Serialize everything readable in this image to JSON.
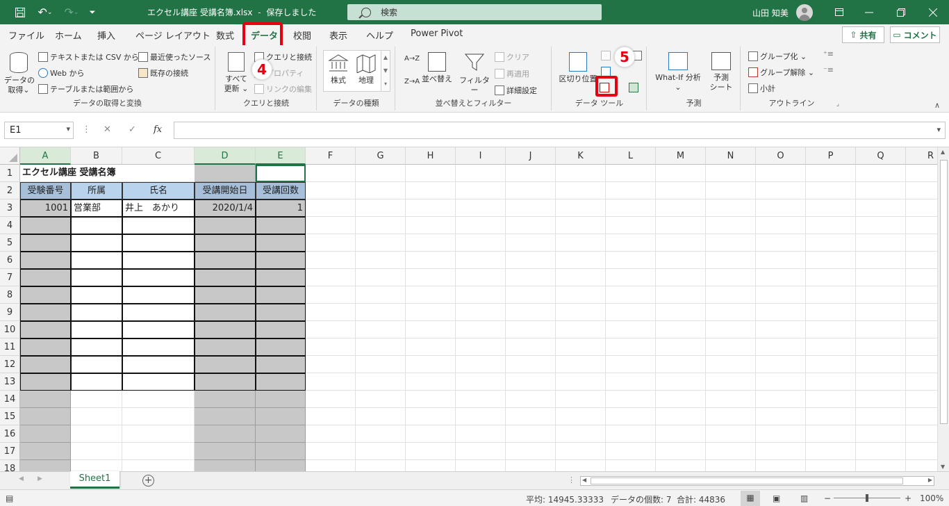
{
  "title": {
    "filename": "エクセル講座 受講名簿.xlsx",
    "sep": "-",
    "status": "保存しました",
    "search": "検索",
    "user": "山田 知美"
  },
  "tabs": [
    "ファイル",
    "ホーム",
    "挿入",
    "ページ レイアウト",
    "数式",
    "データ",
    "校閲",
    "表示",
    "ヘルプ",
    "Power Pivot"
  ],
  "share": "共有",
  "comment": "コメント",
  "ribbon": {
    "get_data": {
      "big": "データの\n取得",
      "big_arrow": "⌄",
      "items": [
        "テキストまたは CSV から",
        "Web から",
        "テーブルまたは範囲から"
      ],
      "items2": [
        "最近使ったソース",
        "既存の接続"
      ],
      "label": "データの取得と変換"
    },
    "queries": {
      "big1": "すべて",
      "big2": "更新",
      "items": [
        "クエリと接続",
        "プロパティ",
        "リンクの編集"
      ],
      "label": "クエリと接続"
    },
    "types": {
      "stock": "株式",
      "geo": "地理",
      "label": "データの種類"
    },
    "sort": {
      "az": "A→Z",
      "za": "Z→A",
      "sort": "並べ替え",
      "filter": "フィルター",
      "clear": "クリア",
      "reapply": "再適用",
      "advanced": "詳細設定",
      "label": "並べ替えとフィルター"
    },
    "tools": {
      "split": "区切り位置",
      "label": "データ ツール"
    },
    "forecast": {
      "whatif": "What-If 分析",
      "sheet1": "予測",
      "sheet2": "シート",
      "label": "予測"
    },
    "outline": {
      "group": "グループ化",
      "ungroup": "グループ解除",
      "subtotal": "小計",
      "label": "アウトライン"
    }
  },
  "markers": {
    "m4": "4",
    "m5": "5"
  },
  "namebox": "E1",
  "fx": "fx",
  "columns": [
    "A",
    "B",
    "C",
    "D",
    "E",
    "F",
    "G",
    "H",
    "I",
    "J",
    "K",
    "L",
    "M",
    "N",
    "O",
    "P",
    "Q",
    "R"
  ],
  "rows": [
    "1",
    "2",
    "3",
    "4",
    "5",
    "6",
    "7",
    "8",
    "9",
    "10",
    "11",
    "12",
    "13",
    "14",
    "15",
    "16",
    "17",
    "18"
  ],
  "cells": {
    "A1": "エクセル講座 受講名簿",
    "A2": "受験番号",
    "B2": "所属",
    "C2": "氏名",
    "D2": "受講開始日",
    "E2": "受講回数",
    "A3": "1001",
    "B3": "営業部",
    "C3": "井上　あかり",
    "D3": "2020/1/4",
    "E3": "1"
  },
  "sheet": "Sheet1",
  "status": {
    "avg": "平均: 14945.33333",
    "count": "データの個数: 7",
    "sum": "合計: 44836",
    "zoom": "100%"
  },
  "colors": {
    "accent": "#217346",
    "highlight": "#e60012",
    "header_fill": "#b9d3ec",
    "gray_fill": "#c8c8c8"
  }
}
